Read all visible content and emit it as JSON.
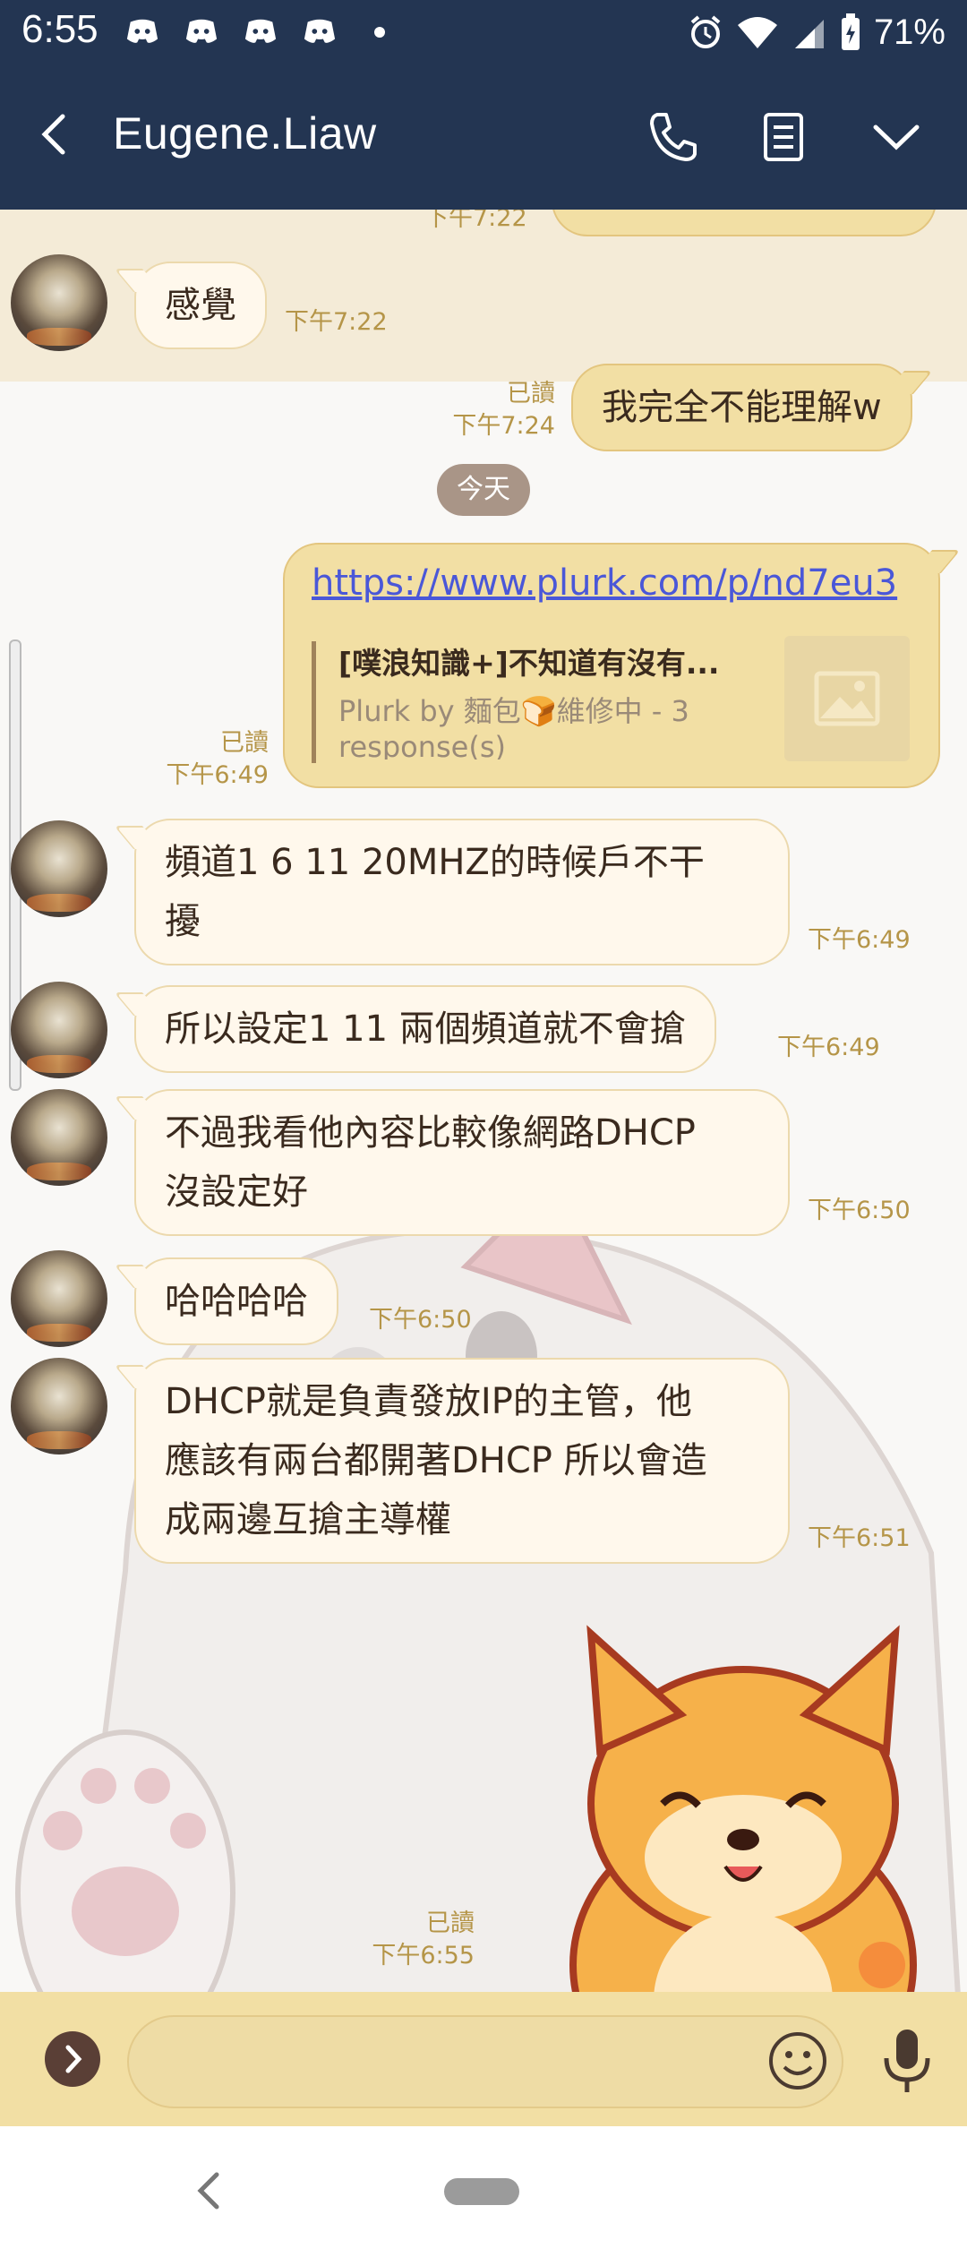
{
  "status_bar": {
    "time": "6:55",
    "battery": "71%"
  },
  "header": {
    "contact_name": "Eugene.Liaw"
  },
  "messages": {
    "partial_top_time": "下午7:22",
    "m1": {
      "text": "感覺",
      "time": "下午7:22"
    },
    "m2": {
      "text": "我完全不能理解w",
      "read": "已讀",
      "time": "下午7:24"
    },
    "day_divider": "今天",
    "link": {
      "url": "https://www.plurk.com/p/nd7eu3",
      "title": "[噗浪知識+]不知道有沒有...",
      "desc": "Plurk by 麵包🍞維修中 - 3 response(s)",
      "read": "已讀",
      "time": "下午6:49"
    },
    "m3": {
      "line1": "頻道1 6 11 20MHZ的時候戶不干",
      "line2": "擾",
      "time": "下午6:49"
    },
    "m4": {
      "text": "所以設定1 11 兩個頻道就不會搶",
      "time": "下午6:49"
    },
    "m5": {
      "line1": "不過我看他內容比較像網路DHCP",
      "line2": "沒設定好",
      "time": "下午6:50"
    },
    "m6": {
      "text": "哈哈哈哈",
      "time": "下午6:50"
    },
    "m7": {
      "line1": "DHCP就是負責發放IP的主管，他",
      "line2": "應該有兩台都開著DHCP 所以會造",
      "line3": "成兩邊互搶主導權",
      "time": "下午6:51"
    },
    "last": {
      "read": "已讀",
      "time": "下午6:55"
    }
  },
  "input": {
    "placeholder": ""
  },
  "colors": {
    "header_bg": "#233552",
    "bubble_me": "#f2dfa4",
    "bubble_them": "#fff8ec",
    "timestamp": "#b59548",
    "link": "#4a57d8"
  },
  "icons": [
    "chevron-left-icon",
    "phone-icon",
    "notes-icon",
    "chevron-down-icon",
    "discord-icon",
    "alarm-icon",
    "wifi-icon",
    "signal-icon",
    "battery-icon",
    "expand-icon",
    "emoji-icon",
    "mic-icon",
    "image-placeholder-icon",
    "nav-back-icon"
  ]
}
